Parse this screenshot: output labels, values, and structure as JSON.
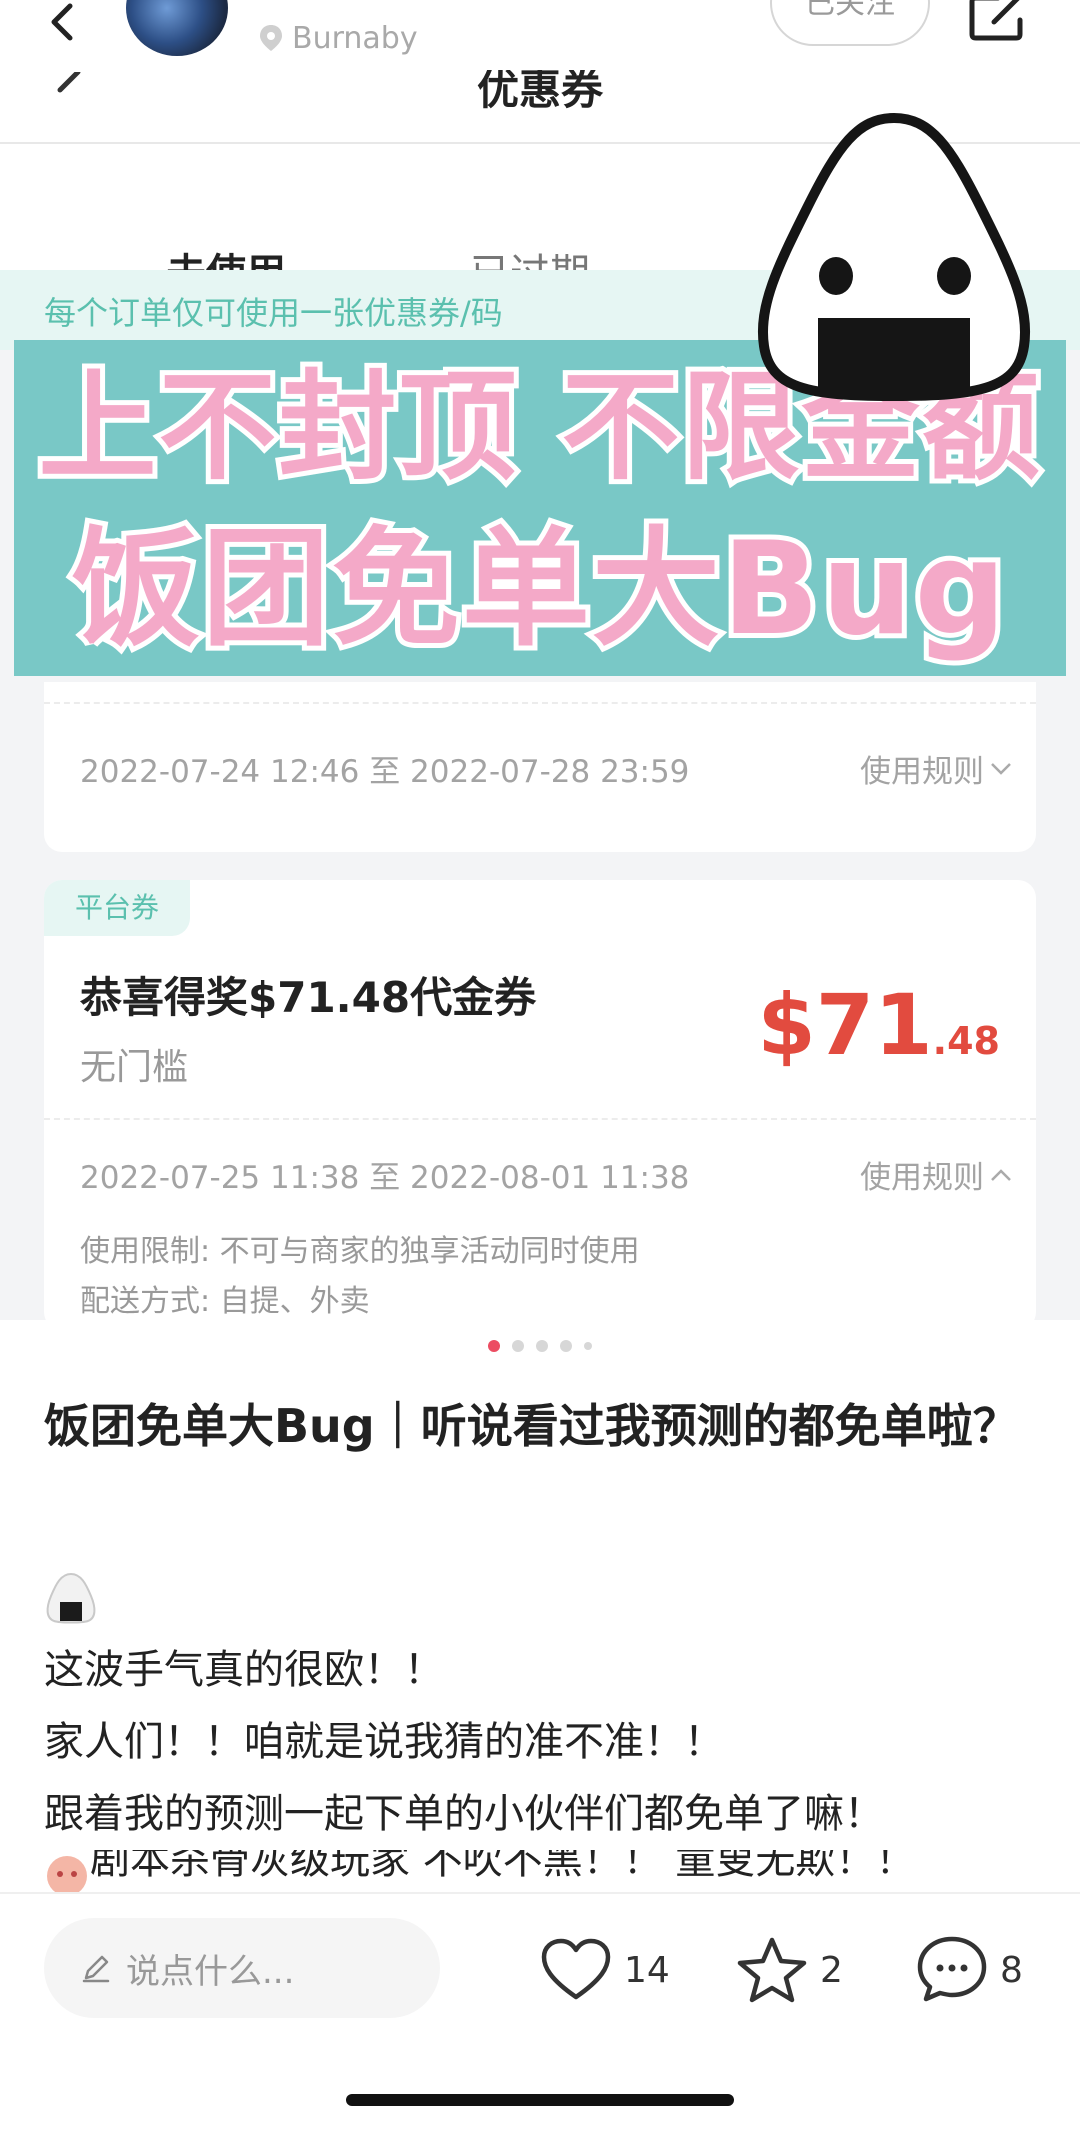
{
  "header": {
    "location": "Burnaby",
    "follow_label": "已关注",
    "icons": {
      "back": "chevron-left-icon",
      "location": "location-pin-icon",
      "share": "share-icon"
    }
  },
  "photo": {
    "inner_title": "优惠券",
    "tabs": [
      "未使用",
      "已过期"
    ],
    "tip": "每个订单仅可使用一张优惠券/码",
    "banner": {
      "line1": "上不封顶 不限金额",
      "line2": "饭团免单大Bug"
    },
    "card_a": {
      "date_range": "2022-07-24 12:46 至 2022-07-28 23:59",
      "rules": "使用规则"
    },
    "card_b": {
      "tag": "平台券",
      "title": "恭喜得奖$71.48代金券",
      "condition": "无门槛",
      "amount_main": "$71",
      "amount_decimal": ".48",
      "date_range": "2022-07-25 11:38 至 2022-08-01 11:38",
      "rules": "使用规则",
      "restriction": "使用限制: 不可与商家的独享活动同时使用",
      "delivery": "配送方式: 自提、外卖"
    },
    "colors": {
      "accent": "#4ec6b3",
      "amount": "#e24b3f",
      "banner_bg": "#79c8c6",
      "banner_text": "#f4a9c8"
    }
  },
  "carousel": {
    "count": 5,
    "active": 1
  },
  "post": {
    "title": "饭团免单大Bug｜听说看过我预测的都免单啦？",
    "lines": [
      "这波手气真的很欧！！",
      "家人们！！咱就是说我猜的准不准！！",
      "跟着我的预测一起下单的小伙伴们都免单了嘛！",
      "剧本杀骨灰级玩家 不吹不黑！！ 童叟无欺！！"
    ]
  },
  "bottom_bar": {
    "comment_placeholder": "说点什么...",
    "likes": "14",
    "collects": "2",
    "comments": "8"
  }
}
